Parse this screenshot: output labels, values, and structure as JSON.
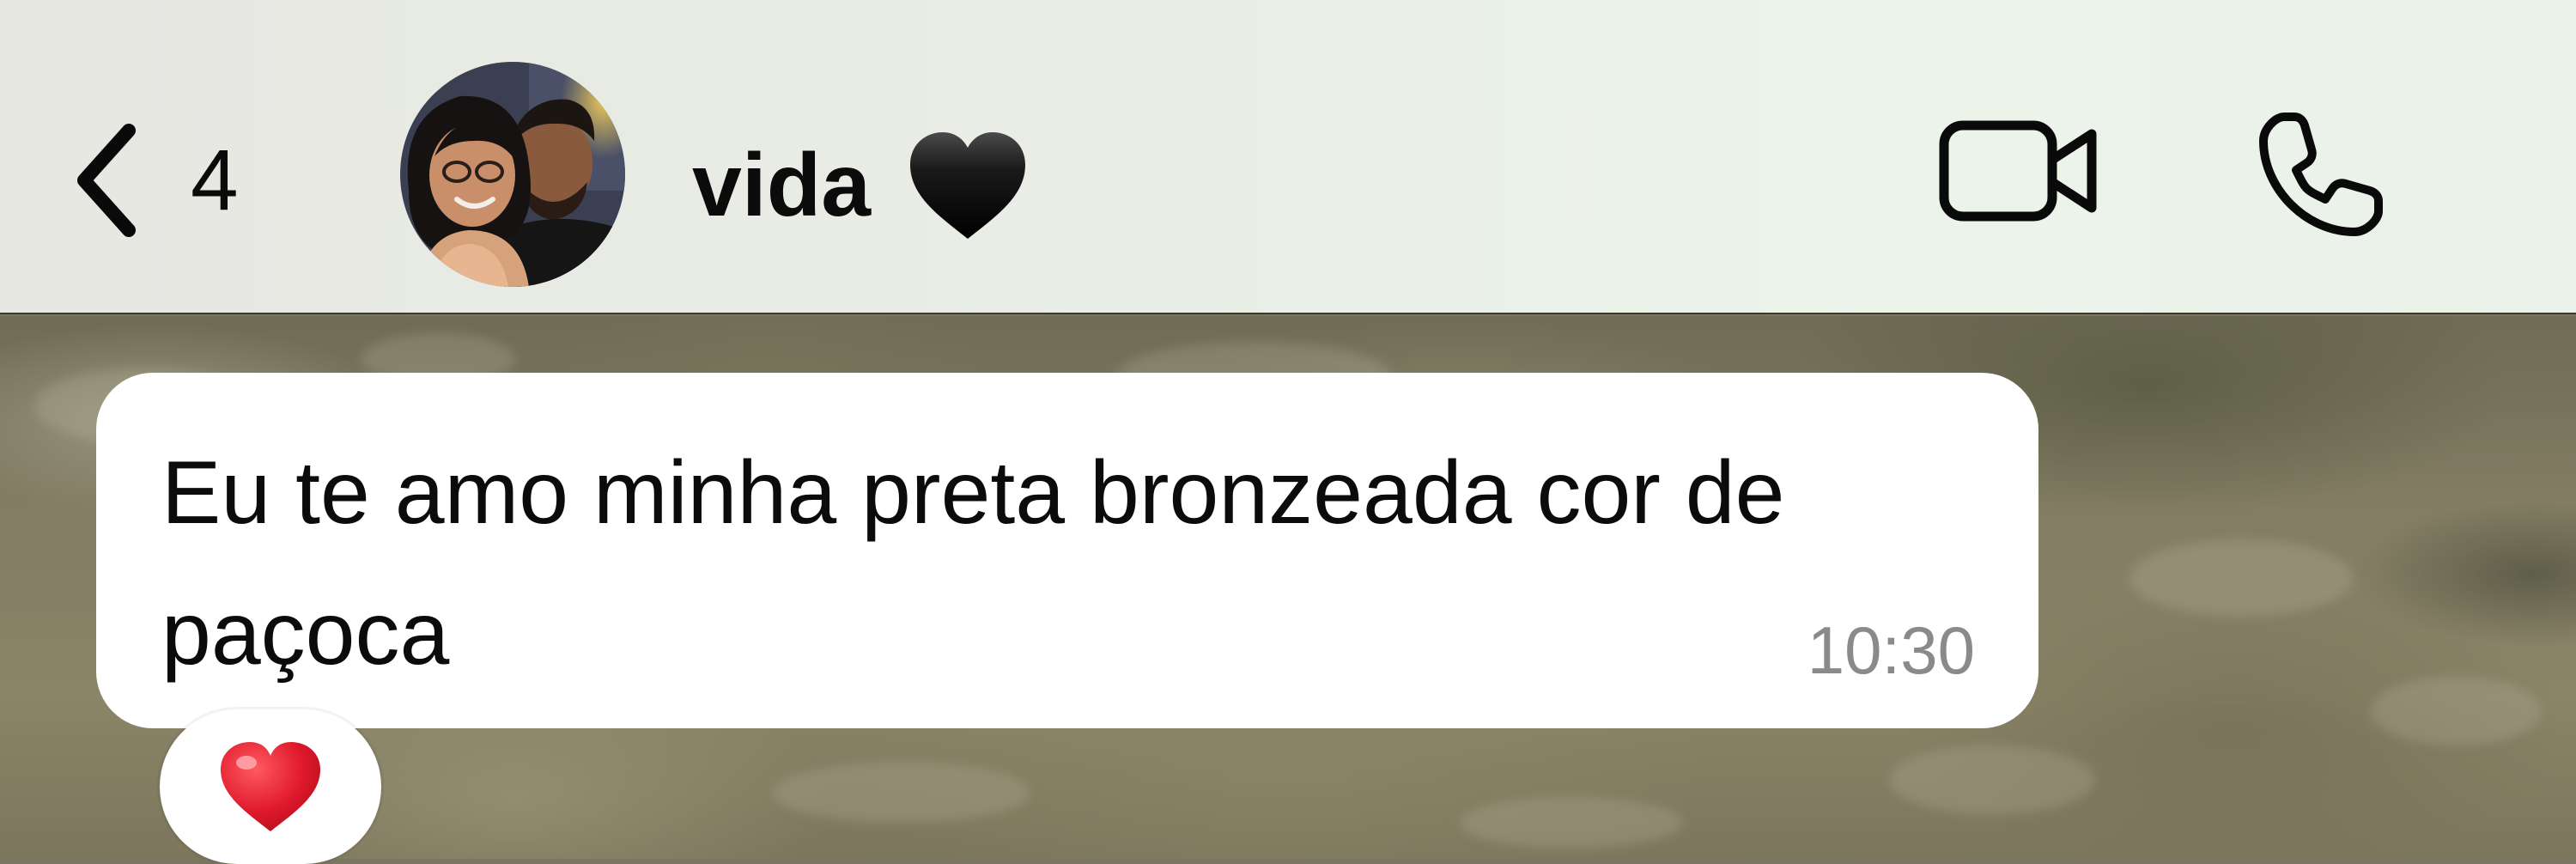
{
  "header": {
    "back_count": "4",
    "contact_name": "vida",
    "name_emoji": "black-heart-emoji",
    "avatar": "contact-photo-couple",
    "actions": [
      "video-camera-icon",
      "phone-icon"
    ]
  },
  "messages": [
    {
      "text": "Eu te amo minha preta bronzeada cor de paçoca",
      "time": "10:30",
      "reaction": "red-heart-emoji"
    }
  ],
  "colors": {
    "header_bg": "#eaf0e7",
    "bubble_bg": "#ffffff",
    "text": "#0b0b0b",
    "timestamp": "#8a8a8a",
    "reaction_heart": "#e0192c"
  }
}
